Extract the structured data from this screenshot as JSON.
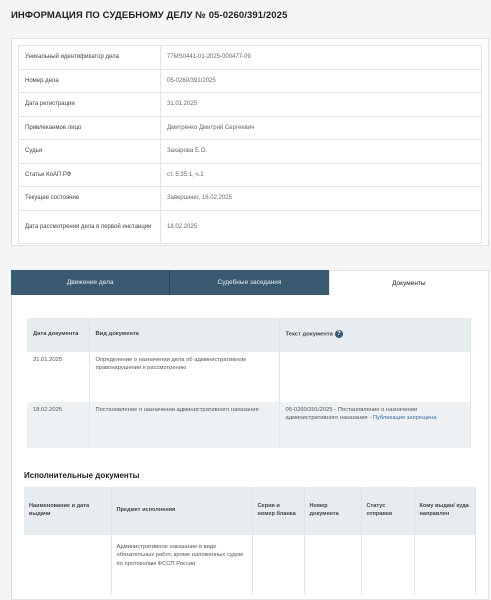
{
  "page": {
    "title": "ИНФОРМАЦИЯ ПО СУДЕБНОМУ ДЕЛУ № 05-0260/391/2025"
  },
  "case_info": [
    {
      "label": "Уникальный идентификатор дела",
      "value": "77MS0441-01-2025-000477-09"
    },
    {
      "label": "Номер дела",
      "value": "05-0260/391/2025"
    },
    {
      "label": "Дата регистрации",
      "value": "31.01.2025"
    },
    {
      "label": "Привлекаемое лицо",
      "value": "Дмитренко Дмитрий Сергеевич"
    },
    {
      "label": "Судья",
      "value": "Захарова Е.О."
    },
    {
      "label": "Статьи КоАП РФ",
      "value": "ст. 5.35.1, ч.1"
    },
    {
      "label": "Текущее состояние",
      "value": "Завершено, 18.02.2025"
    },
    {
      "label": "Дата рассмотрения дела в первой инстанции",
      "value": "18.02.2025"
    }
  ],
  "tabs": [
    "Движение дела",
    "Судебные заседания",
    "Документы"
  ],
  "documents": {
    "headers": [
      "Дата документа",
      "Вид документа",
      "Текст документа"
    ],
    "rows": [
      {
        "date": "31.01.2025",
        "type": "Определение о назначении дела об административном правонарушении к рассмотрению",
        "text": "",
        "link": ""
      },
      {
        "date": "18.02.2025",
        "type": "Постановление о назначении административного наказания",
        "text": "05-0260/391/2025 - Постановление о назначении административного наказания - ",
        "link": "Публикация запрещена"
      }
    ]
  },
  "executive": {
    "title": "Исполнительные документы",
    "headers": [
      "Наименование и дата выдачи",
      "Предмет исполнения",
      "Серия и номер бланка",
      "Номер документа",
      "Статус отправки",
      "Кому выдан/ куда направлен"
    ],
    "rows": [
      {
        "name": "",
        "subject": "Административное наказание в виде обязательных работ, кроме наложенных судом по протоколам ФССП России",
        "series": "",
        "number": "",
        "status": "",
        "recipient": ""
      }
    ]
  },
  "colors": {
    "tab_dark": "#3a5a72",
    "link": "#3a6ea5",
    "header_bg": "#e7ecf0"
  }
}
